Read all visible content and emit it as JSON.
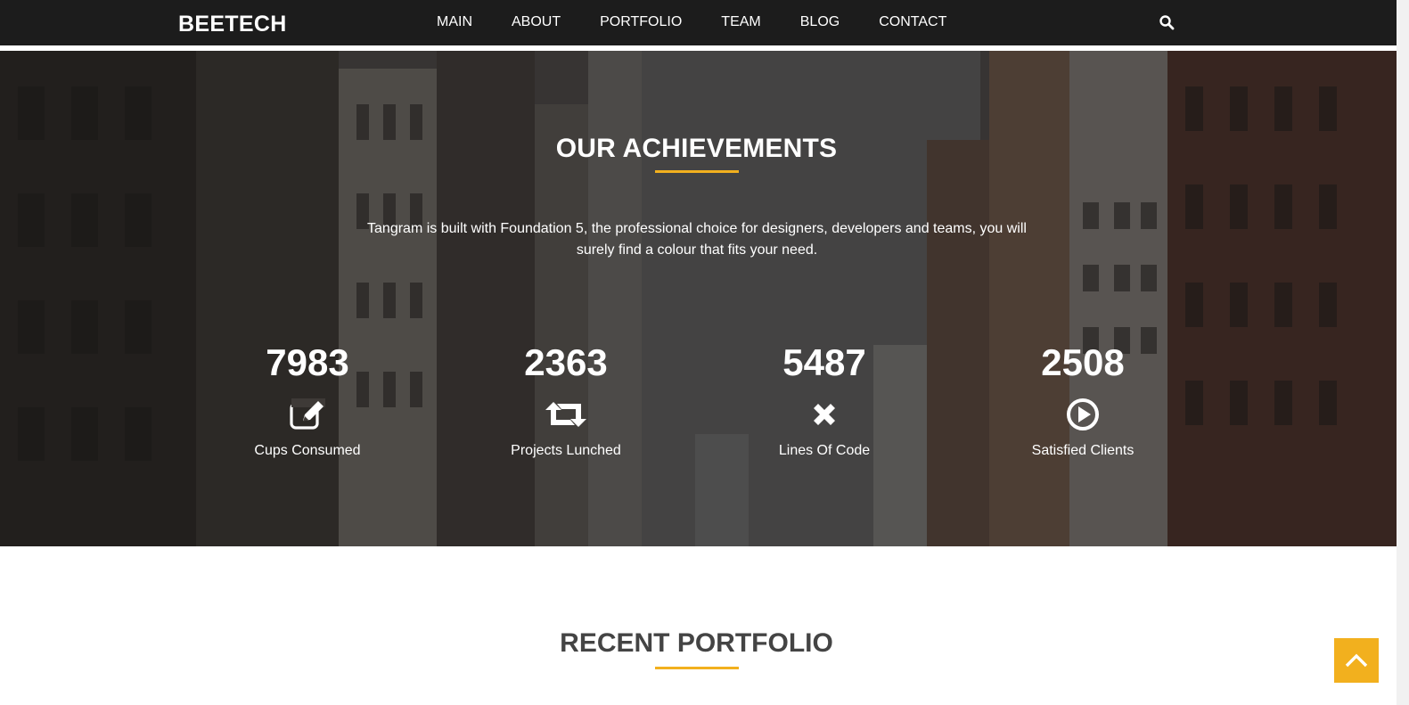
{
  "navbar": {
    "brand": "BEETECH",
    "items": [
      {
        "label": "MAIN"
      },
      {
        "label": "ABOUT"
      },
      {
        "label": "PORTFOLIO"
      },
      {
        "label": "TEAM"
      },
      {
        "label": "BLOG"
      },
      {
        "label": "CONTACT"
      }
    ],
    "search_icon": "search-icon"
  },
  "achievements": {
    "title": "OUR ACHIEVEMENTS",
    "description": "Tangram is built with Foundation 5, the professional choice for designers, developers and teams, you will surely find a colour that fits your need.",
    "stats": [
      {
        "number": "7983",
        "label": "Cups Consumed",
        "icon": "pencil-square-icon"
      },
      {
        "number": "2363",
        "label": "Projects Lunched",
        "icon": "retweet-icon"
      },
      {
        "number": "5487",
        "label": "Lines Of Code",
        "icon": "close-icon"
      },
      {
        "number": "2508",
        "label": "Satisfied Clients",
        "icon": "play-circle-icon"
      }
    ]
  },
  "portfolio": {
    "title": "RECENT PORTFOLIO"
  },
  "scroll_top": {
    "icon": "chevron-up-icon"
  },
  "colors": {
    "accent": "#f2b01e",
    "navbar_bg": "#1c1c1c",
    "heading_dark": "#444444"
  }
}
